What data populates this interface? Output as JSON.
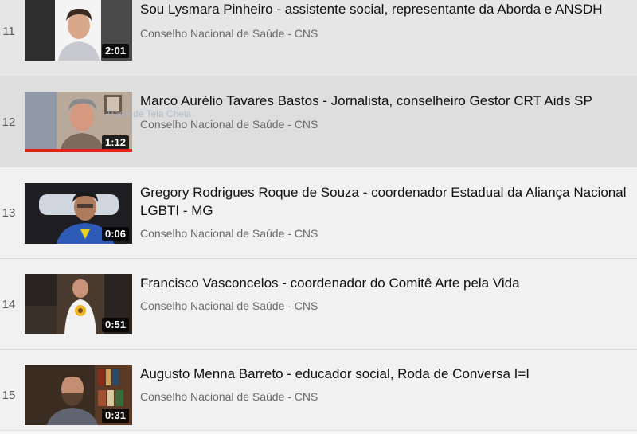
{
  "playlist": {
    "items": [
      {
        "index": "11",
        "title": "Sou Lysmara Pinheiro - assistente social, representante da Aborda e ANSDH",
        "channel": "Conselho Nacional de Saúde - CNS",
        "duration": "2:01"
      },
      {
        "index": "12",
        "title": "Marco Aurélio Tavares Bastos - Jornalista, conselheiro Gestor CRT Aids SP",
        "channel": "Conselho Nacional de Saúde - CNS",
        "duration": "1:12",
        "watched_fraction": 1.0,
        "tooltip": "Parte de Tela Cheia"
      },
      {
        "index": "13",
        "title": "Gregory Rodrigues Roque de Souza - coordenador Estadual da Aliança Nacional LGBTI - MG",
        "channel": "Conselho Nacional de Saúde - CNS",
        "duration": "0:06"
      },
      {
        "index": "14",
        "title": "Francisco Vasconcelos - coordenador do Comitê Arte pela Vida",
        "channel": "Conselho Nacional de Saúde - CNS",
        "duration": "0:51"
      },
      {
        "index": "15",
        "title": "Augusto Menna Barreto - educador social, Roda de Conversa I=I",
        "channel": "Conselho Nacional de Saúde - CNS",
        "duration": "0:31"
      }
    ],
    "colors": {
      "progress": "#e62117",
      "active_row": "#dedede",
      "background": "#f1f1f1"
    }
  }
}
